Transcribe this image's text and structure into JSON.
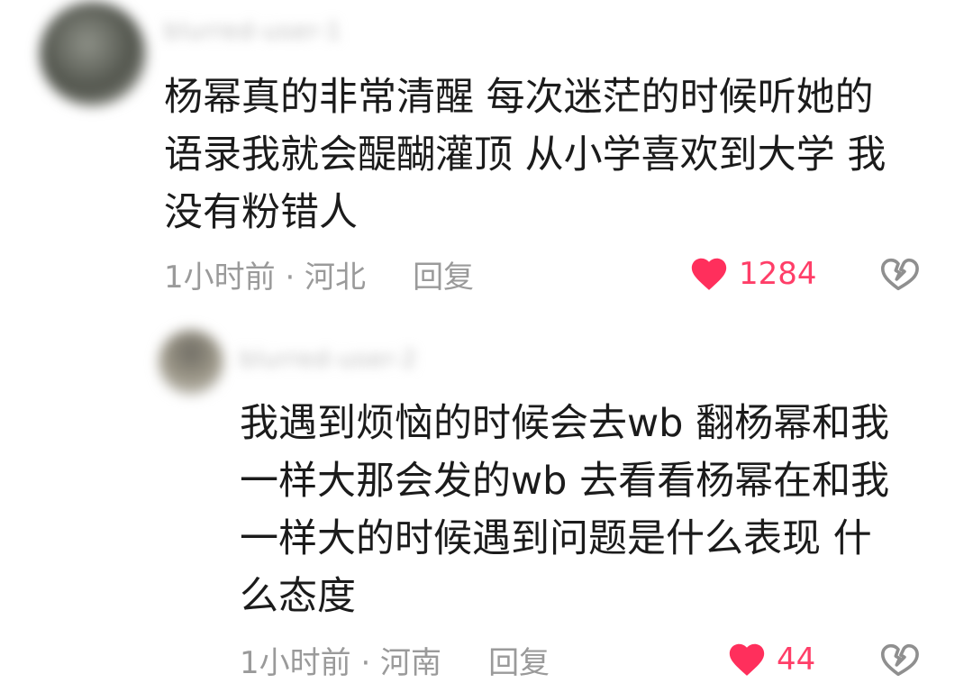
{
  "comments": [
    {
      "avatar": "user-avatar",
      "username": "blurred-user-1",
      "text_lines": [
        "杨幂真的非常清醒 每次迷茫的时候听她的",
        "语录我就会醍醐灌顶 从小学喜欢到大学 我",
        "没有粉错人"
      ],
      "meta": {
        "time_location": "1小时前 · 河北",
        "reply_label": "回复"
      },
      "likes": "1284",
      "icons": {
        "like": "heart-icon",
        "dislike": "broken-heart-icon"
      },
      "colors": {
        "like": "#ff2f5c"
      }
    },
    {
      "avatar": "user-avatar",
      "username": "blurred-user-2",
      "text_lines": [
        "我遇到烦恼的时候会去wb 翻杨幂和我",
        "一样大那会发的wb 去看看杨幂在和我",
        "一样大的时候遇到问题是什么表现 什",
        "么态度"
      ],
      "meta": {
        "time_location": "1小时前 · 河南",
        "reply_label": "回复"
      },
      "likes": "44",
      "icons": {
        "like": "heart-icon",
        "dislike": "broken-heart-icon"
      },
      "colors": {
        "like": "#ff2f5c"
      }
    }
  ]
}
